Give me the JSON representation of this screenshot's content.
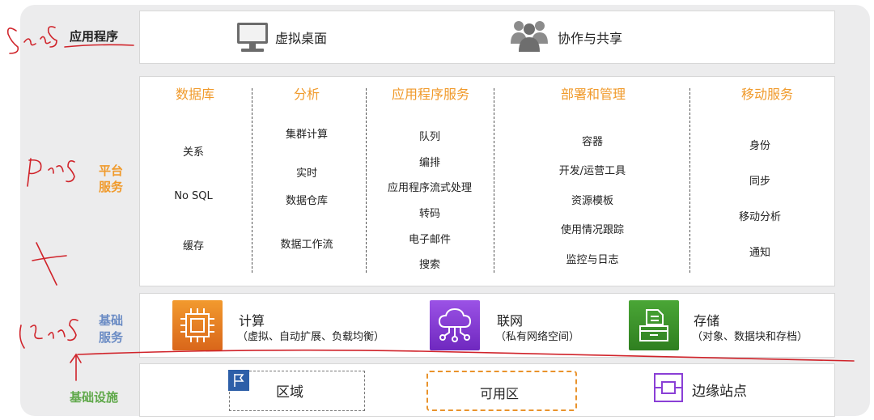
{
  "saas": {
    "label": "应用程序",
    "items": [
      {
        "label": "虚拟桌面",
        "icon": "desktop-monitor-icon"
      },
      {
        "label": "协作与共享",
        "icon": "people-group-icon"
      }
    ]
  },
  "paas": {
    "label_line1": "平台",
    "label_line2": "服务",
    "columns": [
      {
        "title": "数据库",
        "items": [
          "关系",
          "No SQL",
          "缓存"
        ]
      },
      {
        "title": "分析",
        "items": [
          "集群计算",
          "实时",
          "数据仓库",
          "数据工作流"
        ]
      },
      {
        "title": "应用程序服务",
        "items": [
          "队列",
          "编排",
          "应用程序流式处理",
          "转码",
          "电子邮件",
          "搜索"
        ]
      },
      {
        "title": "部署和管理",
        "items": [
          "容器",
          "开发/运营工具",
          "资源模板",
          "使用情况跟踪",
          "监控与日志"
        ]
      },
      {
        "title": "移动服务",
        "items": [
          "身份",
          "同步",
          "移动分析",
          "通知"
        ]
      }
    ]
  },
  "iaas": {
    "label_line1": "基础",
    "label_line2": "服务",
    "services": [
      {
        "title": "计算",
        "subtitle": "（虚拟、自动扩展、负载均衡）",
        "icon": "compute-chip-icon",
        "color": "#e8791b"
      },
      {
        "title": "联网",
        "subtitle": "（私有网络空间）",
        "icon": "cloud-network-icon",
        "color": "#8a3fd6"
      },
      {
        "title": "存储",
        "subtitle": "（对象、数据块和存档）",
        "icon": "storage-bucket-icon",
        "color": "#3b8f2a"
      }
    ]
  },
  "infra": {
    "label": "基础设施",
    "items": [
      {
        "label": "区域",
        "icon": "region-flag-icon"
      },
      {
        "label": "可用区",
        "icon": ""
      },
      {
        "label": "边缘站点",
        "icon": "edge-location-icon"
      }
    ]
  },
  "annotations": {
    "saas": "SaaS",
    "paas": "PaaS",
    "iaas": "IaaS"
  },
  "colors": {
    "accent_orange": "#f09a2b",
    "iaas_blue": "#6a8bc4",
    "infra_green": "#5fa84a",
    "handwriting_red": "#d0232a"
  }
}
